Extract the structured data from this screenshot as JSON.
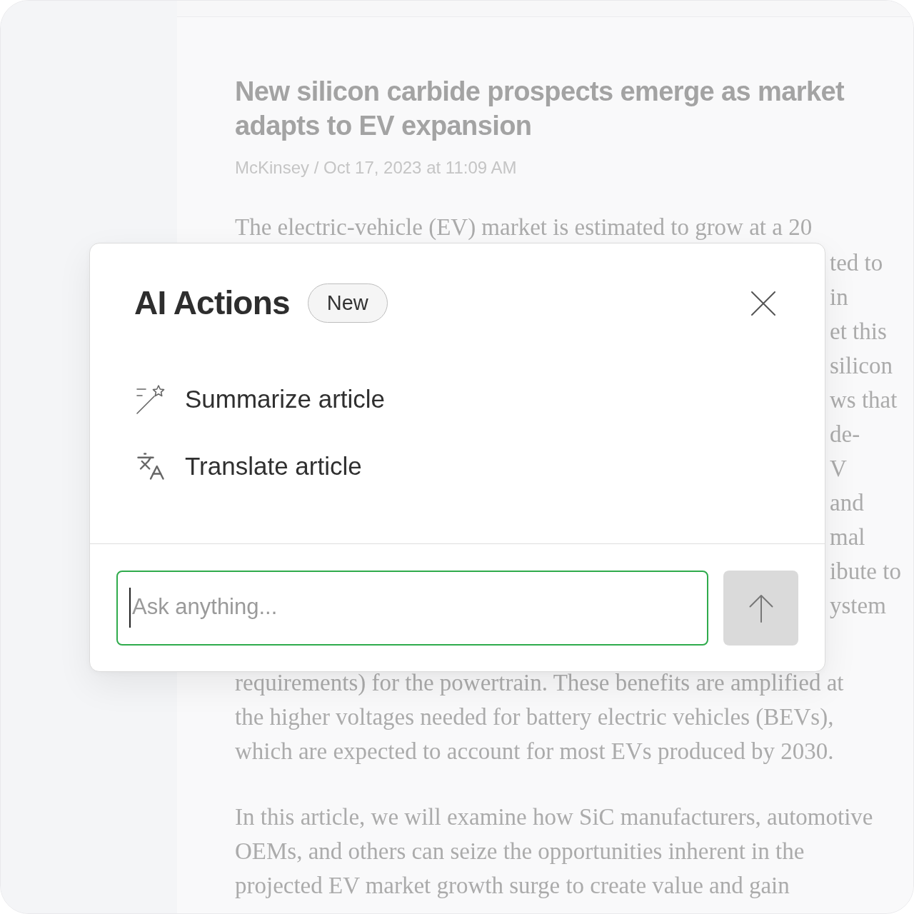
{
  "article": {
    "title": "New silicon carbide prospects emerge as market adapts to EV expansion",
    "byline": "McKinsey / Oct 17, 2023 at 11:09 AM",
    "body_top_line": "The electric-vehicle (EV) market is estimated to grow at a 20",
    "body_beside_dialog": [
      "ted to",
      "in",
      "et this",
      "silicon",
      "ws that",
      "de-",
      "V",
      "and",
      "mal",
      "ibute to",
      "ystem"
    ],
    "body_below_dialog": [
      "requirements) for the powertrain. These benefits are amplified at",
      "the higher voltages needed for battery electric vehicles (BEVs),",
      "which are expected to account for most EVs produced by 2030."
    ],
    "paragraph_2": [
      "In this article, we will examine how SiC manufacturers, automotive",
      "OEMs, and others can seize the opportunities inherent in the",
      "projected EV market growth surge to create value and gain"
    ]
  },
  "dialog": {
    "title": "AI Actions",
    "badge": "New",
    "actions": [
      {
        "kind": "summarize",
        "label": "Summarize article"
      },
      {
        "kind": "translate",
        "label": "Translate article"
      }
    ],
    "input": {
      "placeholder": "Ask anything...",
      "focused": true
    }
  }
}
